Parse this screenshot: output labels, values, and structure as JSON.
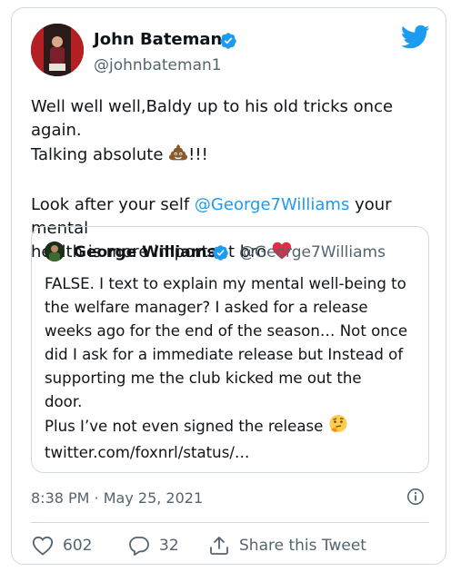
{
  "author": {
    "name": "John Bateman",
    "handle": "@johnbateman1"
  },
  "tweet": {
    "line1": "Well well well,Baldy up to his old tricks once again.",
    "line2_prefix": "Talking absolute",
    "line2_suffix": "!!!",
    "line3_prefix": "Look after your self",
    "mention": "@George7Williams",
    "line3_suffix": "your mental",
    "line4": "health is more important bro"
  },
  "quoted": {
    "name": "George Williams",
    "handle": "@George7Williams",
    "lines": [
      "FALSE. I text to explain my mental well-being to",
      "the welfare manager? I asked for a release",
      "weeks ago for the end of the season… Not once",
      "did I ask for a immediate release but Instead of",
      "supporting me the club kicked me out the",
      "door."
    ],
    "last_line": "Plus I’ve not even signed the release",
    "link": "twitter.com/foxnrl/status/…"
  },
  "timestamp": "8:38 PM · May 25, 2021",
  "actions": {
    "likes": "602",
    "replies": "32",
    "share_label": "Share this Tweet"
  },
  "colors": {
    "accent": "#1d9bf0",
    "like_heart": "#e0245e",
    "text": "#0f1419",
    "secondary": "#536471",
    "border": "#cfd9de"
  },
  "icons": [
    "twitter-bird-icon",
    "verified-badge-icon",
    "poop-emoji-icon",
    "red-heart-emoji-icon",
    "thinking-face-emoji-icon",
    "info-icon",
    "heart-icon",
    "reply-icon",
    "share-icon"
  ]
}
